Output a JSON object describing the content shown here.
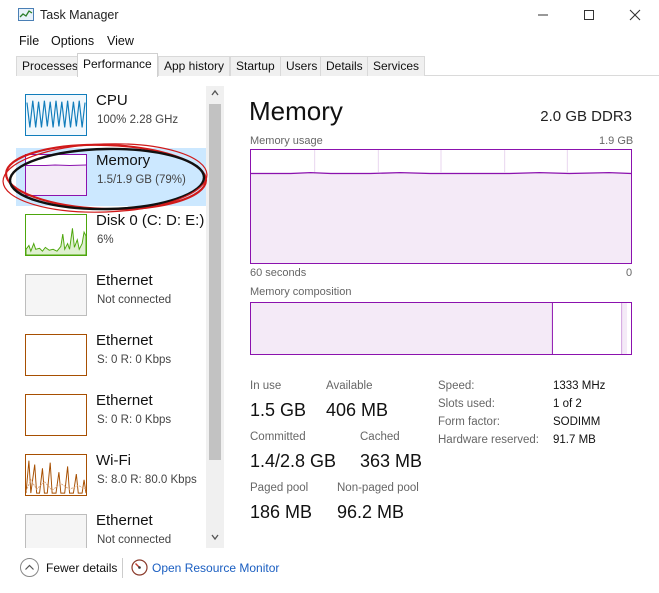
{
  "window": {
    "title": "Task Manager"
  },
  "menu": {
    "items": [
      "File",
      "Options",
      "View"
    ]
  },
  "tabs": [
    "Processes",
    "Performance",
    "App history",
    "Startup",
    "Users",
    "Details",
    "Services"
  ],
  "active_tab": "Performance",
  "sidebar": {
    "items": [
      {
        "name": "CPU",
        "sub": "100% 2.28 GHz",
        "color": "#117dbb",
        "selected": false
      },
      {
        "name": "Memory",
        "sub": "1.5/1.9 GB (79%)",
        "color": "#8b12ae",
        "selected": true
      },
      {
        "name": "Disk 0 (C: D: E:)",
        "sub": "6%",
        "color": "#4da60c",
        "selected": false
      },
      {
        "name": "Ethernet",
        "sub": "Not connected",
        "color": "#999999",
        "selected": false
      },
      {
        "name": "Ethernet",
        "sub": "S: 0 R: 0 Kbps",
        "color": "#a74f01",
        "selected": false
      },
      {
        "name": "Ethernet",
        "sub": "S: 0 R: 0 Kbps",
        "color": "#a74f01",
        "selected": false
      },
      {
        "name": "Wi-Fi",
        "sub": "S: 8.0 R: 80.0 Kbps",
        "color": "#a74f01",
        "selected": false
      },
      {
        "name": "Ethernet",
        "sub": "Not connected",
        "color": "#999999",
        "selected": false
      }
    ]
  },
  "memory": {
    "title": "Memory",
    "spec": "2.0 GB DDR3",
    "usage_label": "Memory usage",
    "usage_max": "1.9 GB",
    "time_label": "60 seconds",
    "time_zero": "0",
    "composition_label": "Memory composition",
    "accent": "#8b12ae",
    "usage_percent": 79,
    "stats": {
      "in_use_label": "In use",
      "in_use": "1.5 GB",
      "available_label": "Available",
      "available": "406 MB",
      "committed_label": "Committed",
      "committed": "1.4/2.8 GB",
      "cached_label": "Cached",
      "cached": "363 MB",
      "paged_label": "Paged pool",
      "paged": "186 MB",
      "nonpaged_label": "Non-paged pool",
      "nonpaged": "96.2 MB"
    },
    "specs": {
      "speed_label": "Speed:",
      "speed": "1333 MHz",
      "slots_label": "Slots used:",
      "slots": "1 of 2",
      "form_label": "Form factor:",
      "form": "SODIMM",
      "reserved_label": "Hardware reserved:",
      "reserved": "91.7 MB"
    }
  },
  "footer": {
    "fewer_details": "Fewer details",
    "open_resmon": "Open Resource Monitor"
  },
  "annotation": {
    "color": "#d11a1a"
  }
}
